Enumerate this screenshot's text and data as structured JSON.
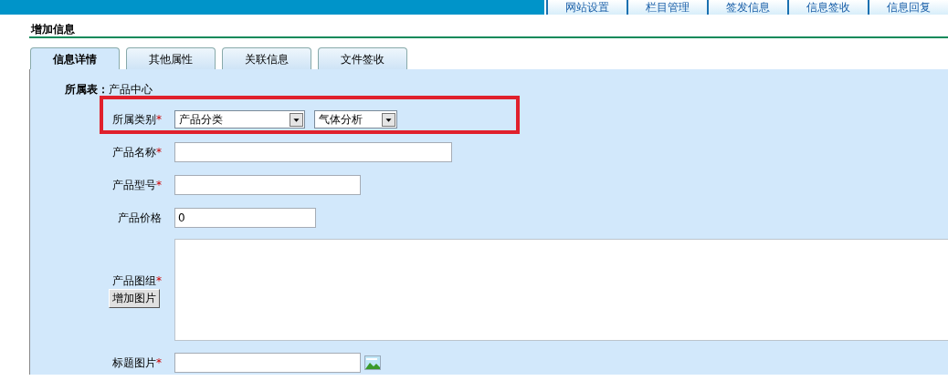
{
  "nav_tabs": [
    {
      "label": "网站设置"
    },
    {
      "label": "栏目管理"
    },
    {
      "label": "签发信息"
    },
    {
      "label": "信息签收"
    },
    {
      "label": "信息回复"
    }
  ],
  "page_title": "增加信息",
  "tabs": [
    {
      "label": "信息详情",
      "selected": true
    },
    {
      "label": "其他属性",
      "selected": false
    },
    {
      "label": "关联信息",
      "selected": false
    },
    {
      "label": "文件签收",
      "selected": false
    }
  ],
  "table": {
    "label": "所属表：",
    "value": "产品中心"
  },
  "fields": [
    {
      "kind": "selects",
      "label": "所属类别",
      "marker": "*",
      "selects": [
        {
          "value": "产品分类"
        },
        {
          "value": "气体分析"
        }
      ]
    },
    {
      "kind": "text",
      "label": "产品名称",
      "marker": "*"
    },
    {
      "kind": "text",
      "label": "产品型号",
      "marker": "*"
    },
    {
      "kind": "text",
      "label": "产品价格",
      "value": "0"
    },
    {
      "kind": "gallery",
      "label": "产品图组",
      "marker": "*",
      "button": "增加图片"
    },
    {
      "kind": "image",
      "label": "标题图片",
      "marker": "*"
    }
  ]
}
